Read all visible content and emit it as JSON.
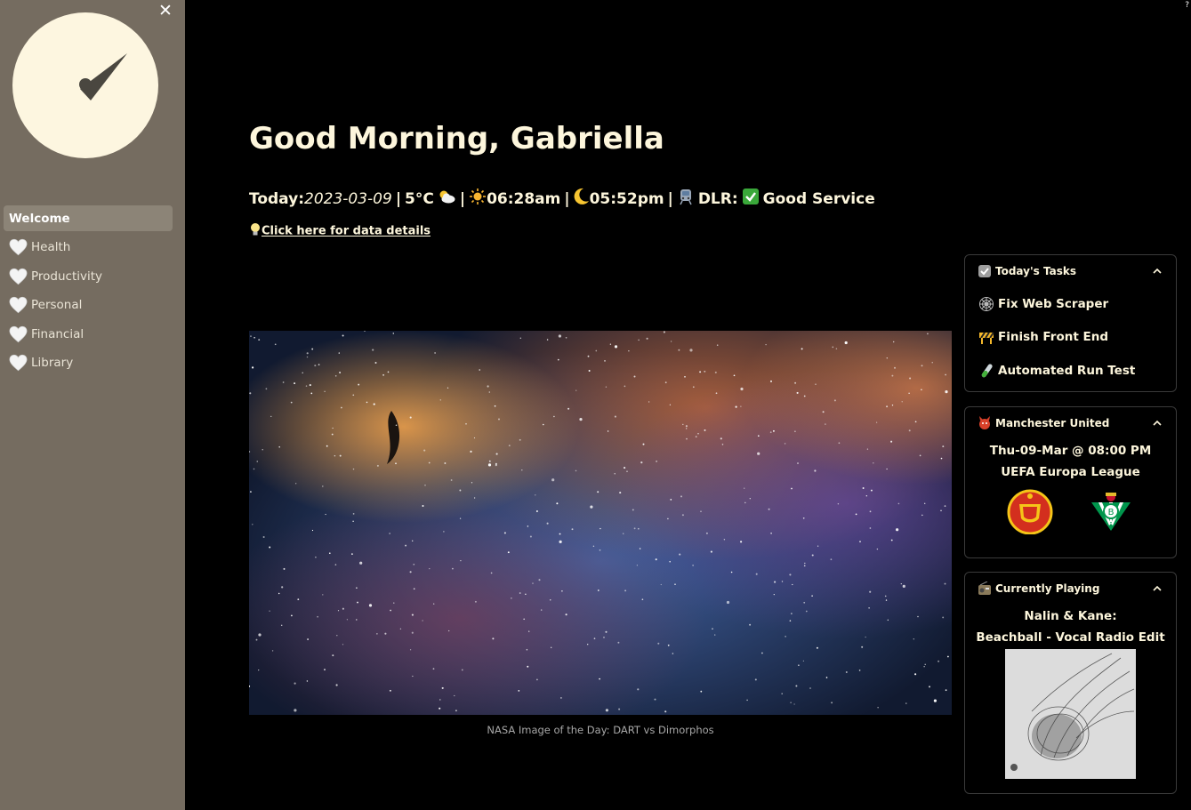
{
  "sidebar": {
    "close_label": "✕",
    "items": [
      {
        "label": "Welcome",
        "active": true,
        "icon": "none"
      },
      {
        "label": "Health",
        "icon": "white-heart-icon"
      },
      {
        "label": "Productivity",
        "icon": "white-heart-icon"
      },
      {
        "label": "Personal",
        "icon": "white-heart-icon"
      },
      {
        "label": "Financial",
        "icon": "white-heart-icon"
      },
      {
        "label": "Library",
        "icon": "white-heart-icon"
      }
    ]
  },
  "header": {
    "greeting": "Good Morning, Gabriella",
    "today_prefix": "Today: ",
    "date": "2023-03-09",
    "temperature": "5°C",
    "sunrise": "06:28am",
    "sunset": "05:52pm",
    "transport_label": "DLR:",
    "transport_status": "Good Service",
    "details_link": "Click here for data details"
  },
  "nasa": {
    "caption": "NASA Image of the Day: DART vs Dimorphos"
  },
  "tasks": {
    "title": "Today's Tasks",
    "items": [
      {
        "label": "Fix Web Scraper",
        "icon": "spider-web-icon"
      },
      {
        "label": "Finish Front End",
        "icon": "construction-barrier-icon"
      },
      {
        "label": "Automated Run Test",
        "icon": "test-tube-icon"
      }
    ]
  },
  "football": {
    "title": "Manchester United",
    "datetime": "Thu-09-Mar @ 08:00 PM",
    "competition": "UEFA Europa League",
    "home_crest": "manchester-united-crest-icon",
    "away_crest": "real-betis-crest-icon"
  },
  "music": {
    "title": "Currently Playing",
    "artist": "Nalin & Kane:",
    "track": "Beachball - Vocal Radio Edit"
  },
  "colors": {
    "sidebar_bg": "#756c60",
    "text_cream": "#fdf6dc",
    "background": "#000000"
  }
}
